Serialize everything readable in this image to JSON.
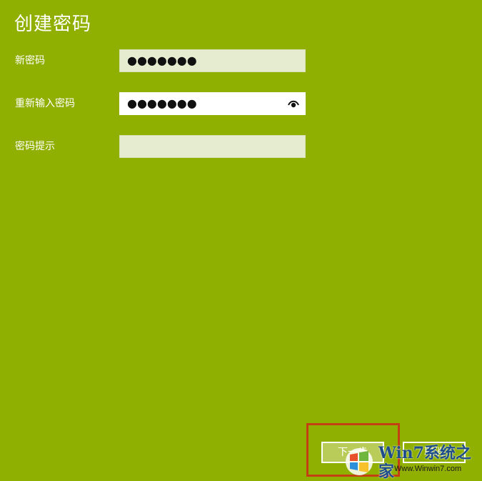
{
  "page": {
    "title": "创建密码",
    "background_color": "#8fb000"
  },
  "form": {
    "new_password": {
      "label": "新密码",
      "value": "●●●●●●●"
    },
    "confirm_password": {
      "label": "重新输入密码",
      "value": "●●●●●●●",
      "reveal_icon": "eye-icon"
    },
    "password_hint": {
      "label": "密码提示",
      "value": ""
    }
  },
  "buttons": {
    "next_label": "下一步",
    "cancel_label": "取消"
  },
  "annotation": {
    "highlight_color": "#c43f12"
  },
  "watermark": {
    "brand": "Win7系统之家",
    "url": "Www.Winwin7.com"
  }
}
